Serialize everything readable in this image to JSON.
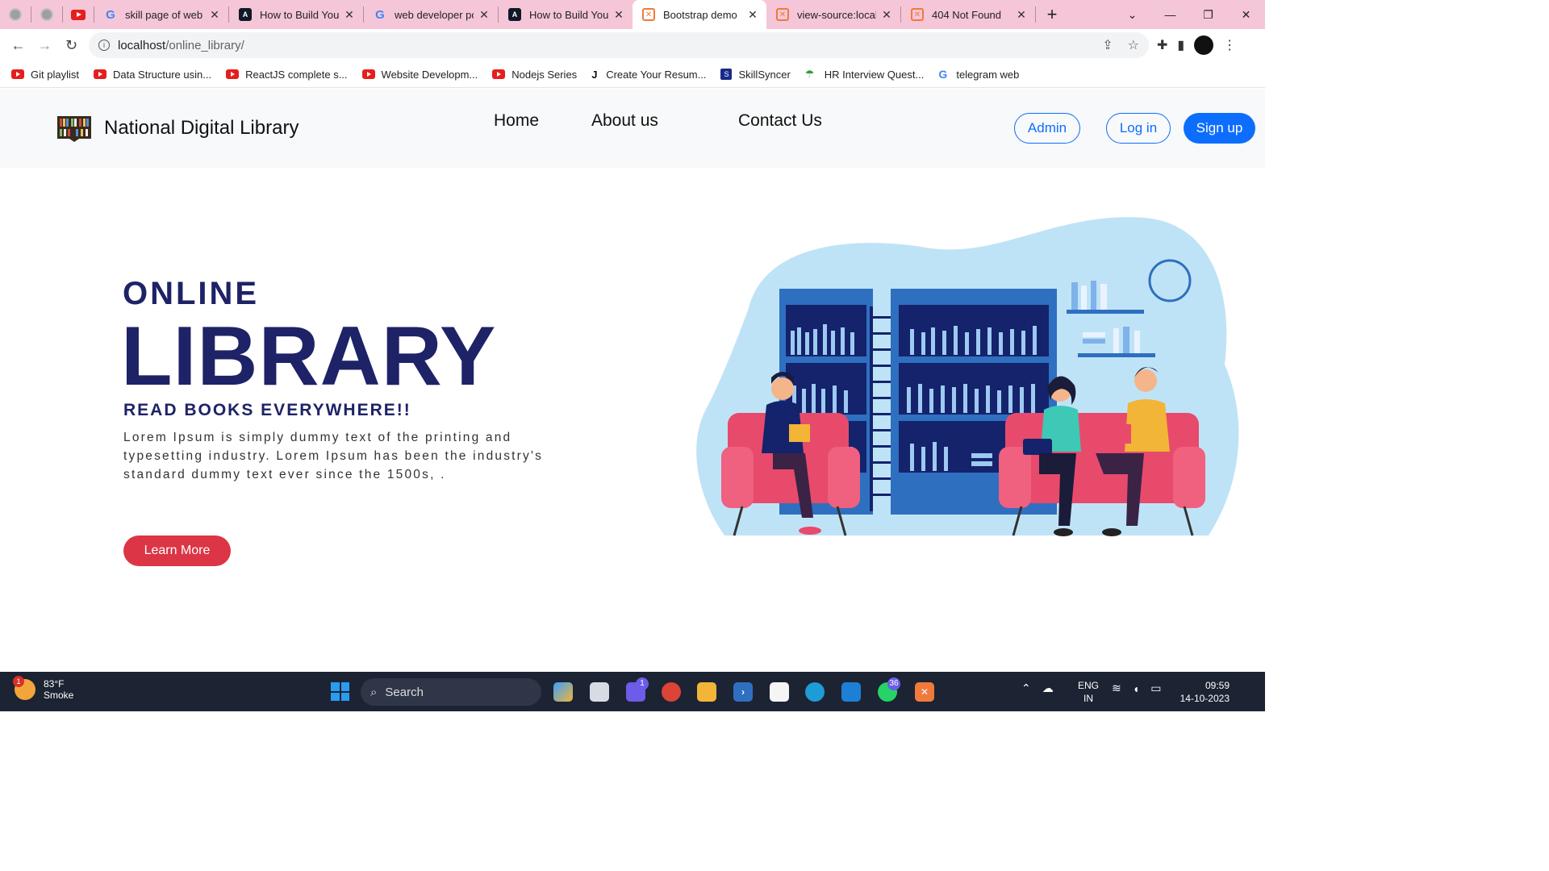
{
  "browser": {
    "tabs": [
      {
        "title": "skill page of web",
        "icon": "google-icon"
      },
      {
        "title": "How to Build Your",
        "icon": "app-icon"
      },
      {
        "title": "web developer po",
        "icon": "google-icon"
      },
      {
        "title": "How to Build Your",
        "icon": "app-icon"
      },
      {
        "title": "Bootstrap demo",
        "icon": "xampp-icon",
        "active": true
      },
      {
        "title": "view-source:locall",
        "icon": "xampp-icon"
      },
      {
        "title": "404 Not Found",
        "icon": "xampp-icon"
      }
    ],
    "address": {
      "host": "localhost",
      "path": "/online_library/"
    },
    "bookmarks": [
      {
        "label": "Git playlist",
        "icon": "youtube-icon"
      },
      {
        "label": "Data Structure usin...",
        "icon": "youtube-icon"
      },
      {
        "label": "ReactJS complete s...",
        "icon": "youtube-icon"
      },
      {
        "label": "Website Developm...",
        "icon": "youtube-icon"
      },
      {
        "label": "Nodejs Series",
        "icon": "youtube-icon"
      },
      {
        "label": "Create Your Resum...",
        "icon": "j-icon"
      },
      {
        "label": "SkillSyncer",
        "icon": "skillsyncer-icon"
      },
      {
        "label": "HR Interview Quest...",
        "icon": "umbrella-icon"
      },
      {
        "label": "telegram web",
        "icon": "google-icon"
      }
    ]
  },
  "site": {
    "brand": "National Digital Library",
    "nav": {
      "home": "Home",
      "about": "About us",
      "contact": "Contact Us"
    },
    "buttons": {
      "admin": "Admin",
      "login": "Log in",
      "signup": "Sign up"
    },
    "colors": {
      "primary": "#0d6efd",
      "heading": "#1e2266",
      "danger": "#dc3545"
    }
  },
  "hero": {
    "eyebrow": "ONLINE",
    "title": "LIBRARY",
    "subtitle": "READ BOOKS EVERYWHERE!!",
    "text": "Lorem Ipsum is simply dummy text of the printing and typesetting industry. Lorem Ipsum has been the industry's standard dummy text ever since the 1500s, .",
    "cta": "Learn More"
  },
  "taskbar": {
    "weather": {
      "temp": "83°F",
      "condition": "Smoke",
      "badge": "1"
    },
    "search": "Search",
    "badges": {
      "teams": "1",
      "whatsapp": "36"
    },
    "lang": {
      "line1": "ENG",
      "line2": "IN"
    },
    "clock": {
      "time": "09:59",
      "date": "14-10-2023"
    }
  }
}
